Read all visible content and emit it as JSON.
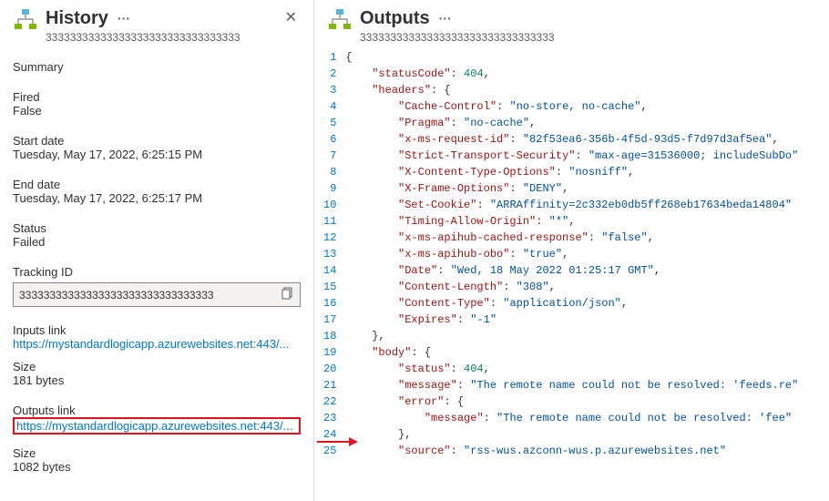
{
  "history": {
    "title": "History",
    "subtitle": "33333333333333333333333333333333",
    "summary_label": "Summary",
    "fired_label": "Fired",
    "fired_value": "False",
    "start_date_label": "Start date",
    "start_date_value": "Tuesday, May 17, 2022, 6:25:15 PM",
    "end_date_label": "End date",
    "end_date_value": "Tuesday, May 17, 2022, 6:25:17 PM",
    "status_label": "Status",
    "status_value": "Failed",
    "tracking_id_label": "Tracking ID",
    "tracking_id_value": "33333333333333333333333333333333",
    "inputs_link_label": "Inputs link",
    "inputs_link_value": "https://mystandardlogicapp.azurewebsites.net:443/...",
    "inputs_size_label": "Size",
    "inputs_size_value": "181 bytes",
    "outputs_link_label": "Outputs link",
    "outputs_link_value": "https://mystandardlogicapp.azurewebsites.net:443/...",
    "outputs_size_label": "Size",
    "outputs_size_value": "1082 bytes"
  },
  "outputs": {
    "title": "Outputs",
    "subtitle": "33333333333333333333333333333333",
    "json": {
      "statusCode": 404,
      "headers": {
        "Cache-Control": "no-store, no-cache",
        "Pragma": "no-cache",
        "x-ms-request-id": "82f53ea6-356b-4f5d-93d5-f7d97d3af5ea",
        "Strict-Transport-Security": "max-age=31536000; includeSubDo",
        "X-Content-Type-Options": "nosniff",
        "X-Frame-Options": "DENY",
        "Set-Cookie": "ARRAffinity=2c332eb0db5ff268eb17634beda14804",
        "Timing-Allow-Origin": "*",
        "x-ms-apihub-cached-response": "false",
        "x-ms-apihub-obo": "true",
        "Date": "Wed, 18 May 2022 01:25:17 GMT",
        "Content-Length": "308",
        "Content-Type": "application/json",
        "Expires": "-1"
      },
      "body": {
        "status": 404,
        "message": "The remote name could not be resolved: 'feeds.re",
        "error": {
          "message": "The remote name could not be resolved: 'fee"
        },
        "source": "rss-wus.azconn-wus.p.azurewebsites.net"
      }
    }
  }
}
